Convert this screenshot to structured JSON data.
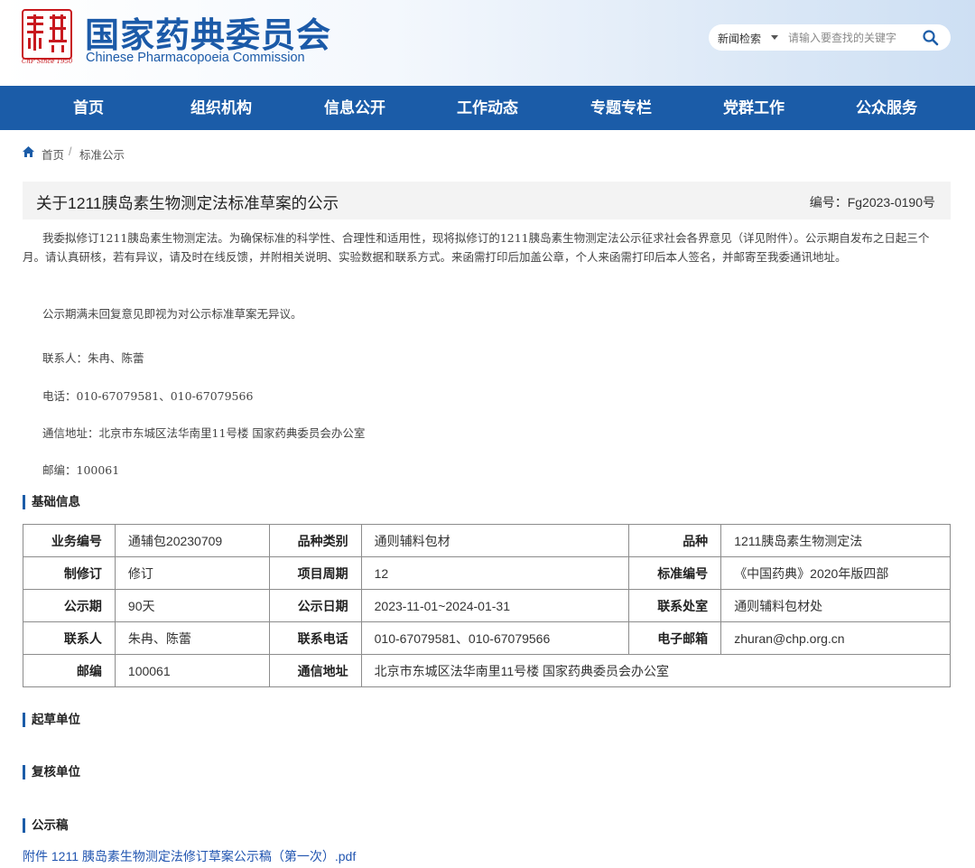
{
  "header": {
    "logo_seal_text": "藥典",
    "logo_since": "ChP Since 1950",
    "site_name_cn": "国家药典委员会",
    "site_name_en": "Chinese Pharmacopoeia Commission",
    "search": {
      "category": "新闻检索",
      "placeholder": "请输入要查找的关键字"
    }
  },
  "nav": {
    "items": [
      "首页",
      "组织机构",
      "信息公开",
      "工作动态",
      "专题专栏",
      "党群工作",
      "公众服务"
    ]
  },
  "breadcrumb": {
    "home": "首页",
    "separator": "/",
    "current": "标准公示"
  },
  "article": {
    "title": "关于1211胰岛素生物测定法标准草案的公示",
    "code": "编号：Fg2023-0190号",
    "intro": "我委拟修订1211胰岛素生物测定法。为确保标准的科学性、合理性和适用性，现将拟修订的1211胰岛素生物测定法公示征求社会各界意见（详见附件）。公示期自发布之日起三个月。请认真研核，若有异议，请及时在线反馈，并附相关说明、实验数据和联系方式。来函需打印后加盖公章，个人来函需打印后本人签名，并邮寄至我委通讯地址。",
    "note": "公示期满未回复意见即视为对公示标准草案无异议。",
    "contact": "联系人：朱冉、陈蕾",
    "phone": "电话：010-67079581、010-67079566",
    "address": "通信地址：北京市东城区法华南里11号楼 国家药典委员会办公室",
    "postcode": "邮编：100061"
  },
  "sections": {
    "basic": "基础信息",
    "draft_unit": "起草单位",
    "review_unit": "复核单位",
    "publication": "公示稿"
  },
  "table": {
    "rows": [
      [
        {
          "label": "业务编号",
          "value": "通辅包20230709"
        },
        {
          "label": "品种类别",
          "value": "通则辅料包材"
        },
        {
          "label": "品种",
          "value": "1211胰岛素生物测定法"
        }
      ],
      [
        {
          "label": "制修订",
          "value": "修订"
        },
        {
          "label": "项目周期",
          "value": "12"
        },
        {
          "label": "标准编号",
          "value": "《中国药典》2020年版四部"
        }
      ],
      [
        {
          "label": "公示期",
          "value": "90天"
        },
        {
          "label": "公示日期",
          "value": "2023-11-01~2024-01-31"
        },
        {
          "label": "联系处室",
          "value": "通则辅料包材处"
        }
      ],
      [
        {
          "label": "联系人",
          "value": "朱冉、陈蕾"
        },
        {
          "label": "联系电话",
          "value": "010-67079581、010-67079566"
        },
        {
          "label": "电子邮箱",
          "value": "zhuran@chp.org.cn"
        }
      ]
    ],
    "last_row": [
      {
        "label": "邮编",
        "value": "100061"
      },
      {
        "label": "通信地址",
        "value": "北京市东城区法华南里11号楼 国家药典委员会办公室"
      }
    ]
  },
  "attachment": {
    "label": "附件 1211 胰岛素生物测定法修订草案公示稿（第一次）.pdf"
  },
  "colors": {
    "brand_blue": "#1b5ca8",
    "seal_red": "#c8181e",
    "link_blue": "#2155b0"
  }
}
